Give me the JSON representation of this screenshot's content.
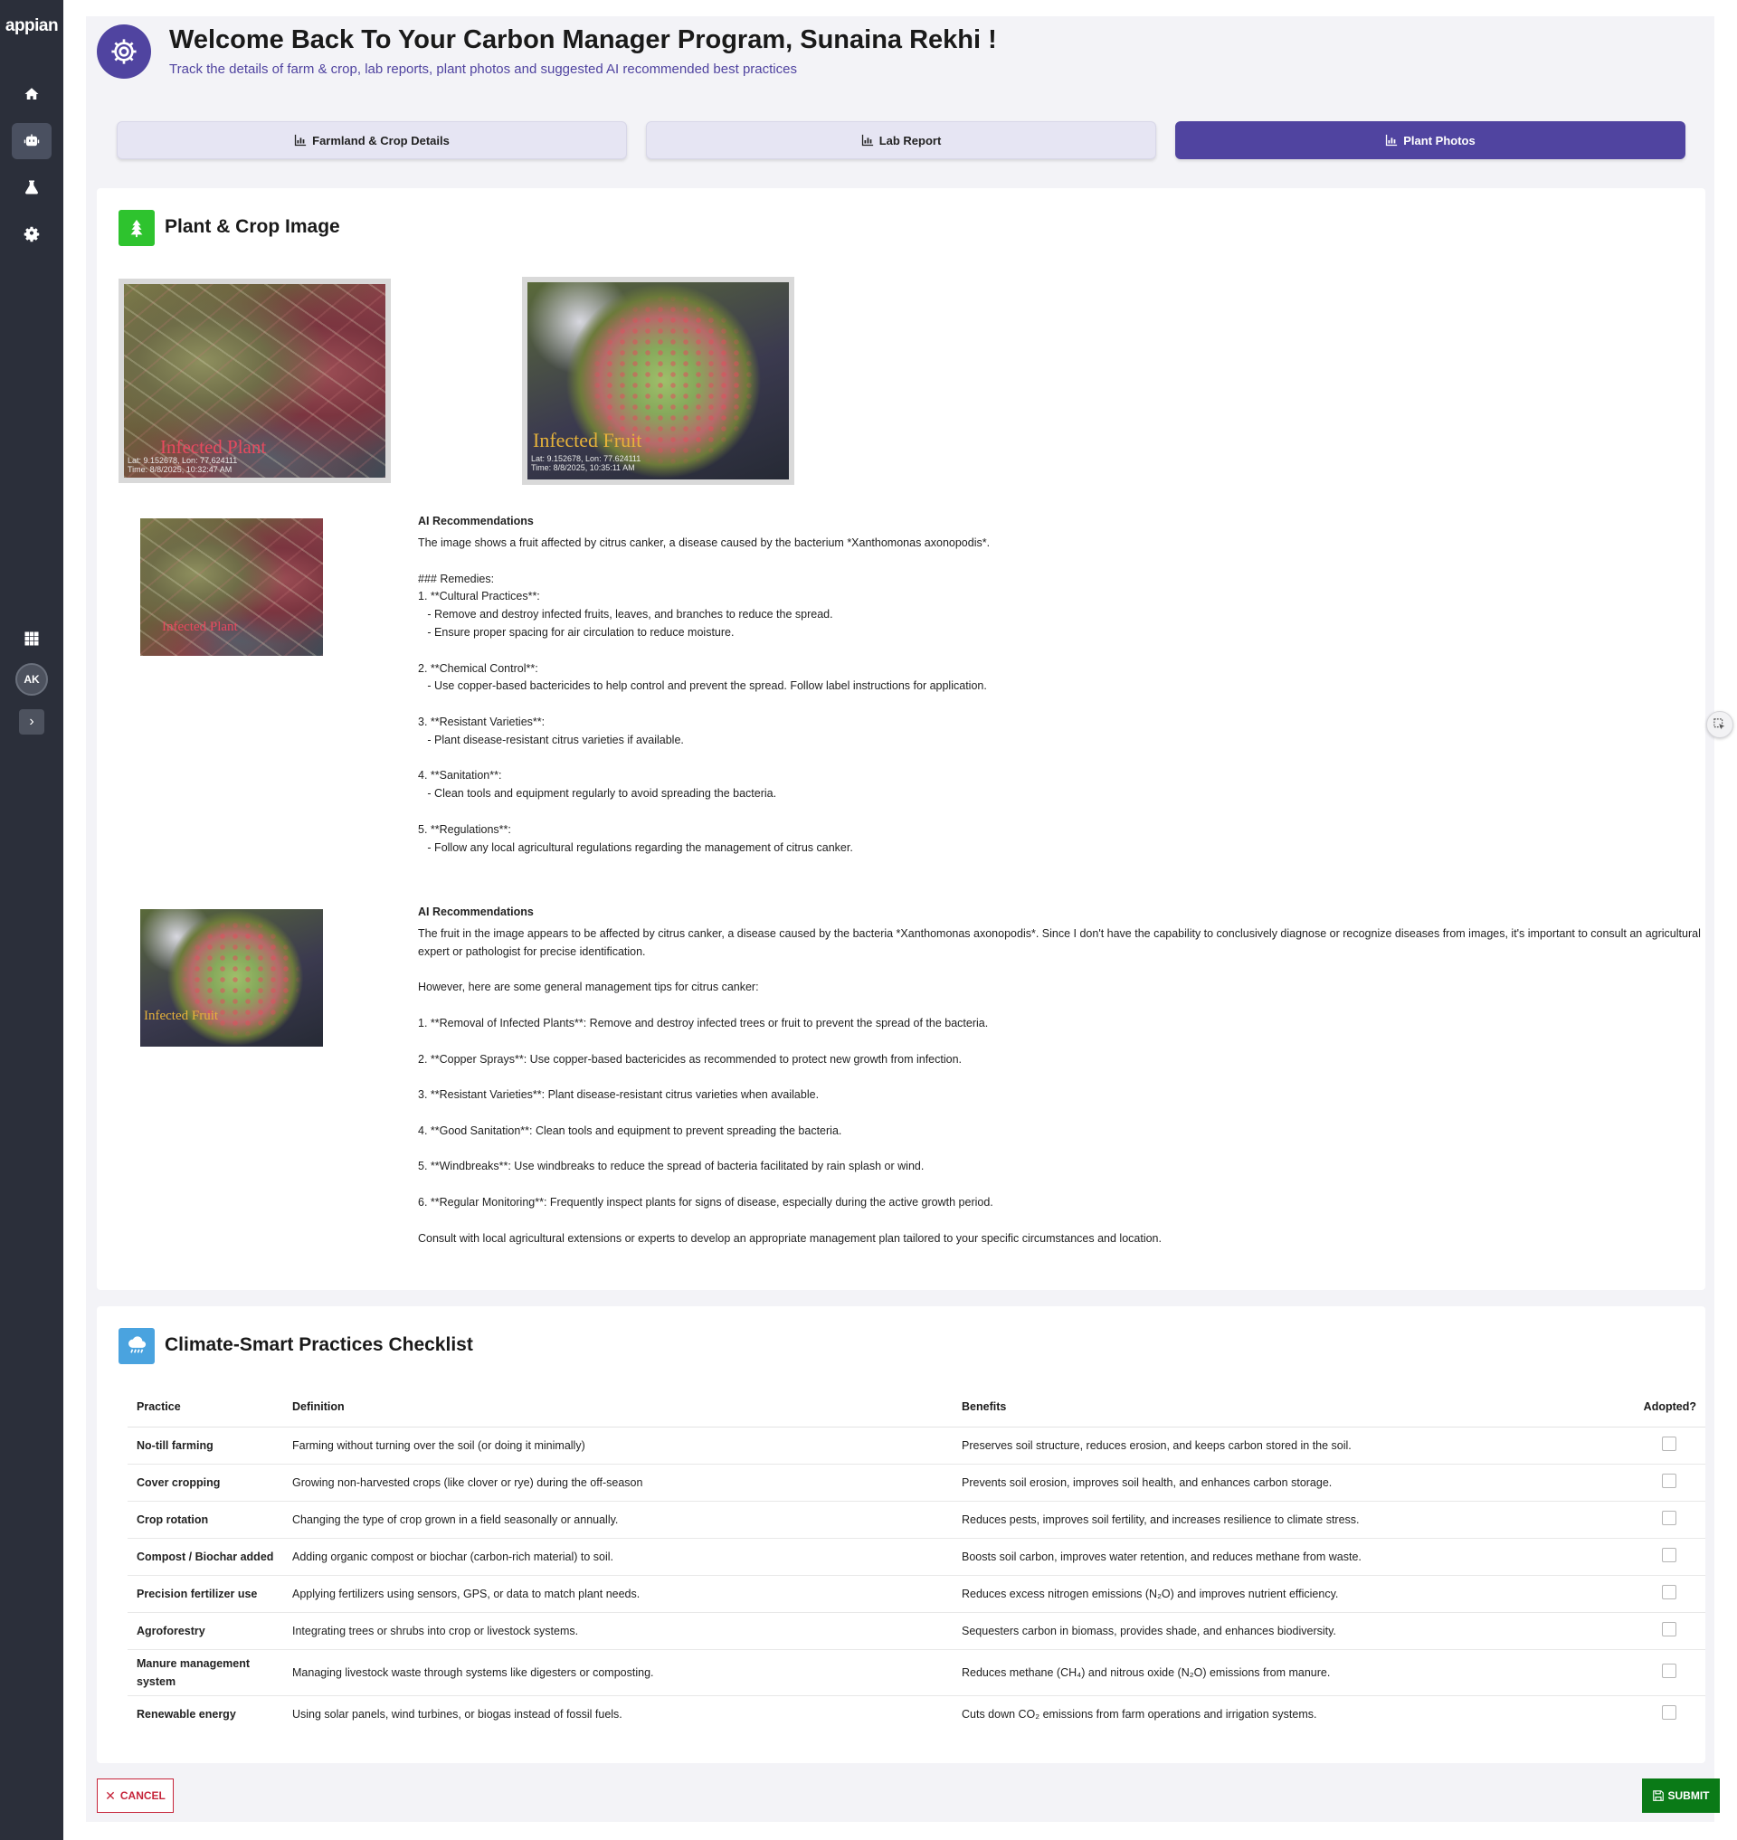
{
  "app": {
    "logo": "appian",
    "user_initials": "AK"
  },
  "colors": {
    "brand": "#5044a0",
    "sidebar": "#2b2f3a",
    "success": "#0a7a17",
    "danger": "#c6253b",
    "plant_icon": "#2ec32e",
    "climate_icon": "#4aa3df"
  },
  "sidebar": {
    "items": [
      {
        "name": "home",
        "icon": "home-icon"
      },
      {
        "name": "robot",
        "icon": "robot-icon",
        "active": true
      },
      {
        "name": "lab",
        "icon": "flask-icon"
      },
      {
        "name": "settings",
        "icon": "gear-icon"
      },
      {
        "name": "apps",
        "icon": "grid-icon"
      }
    ],
    "expand_icon": "chevron-right-icon"
  },
  "header": {
    "title": "Welcome Back To Your Carbon Manager Program, Sunaina Rekhi !",
    "subtitle": "Track the details of farm & crop, lab reports, plant photos and suggested AI recommended best practices",
    "icon": "gear-icon"
  },
  "tabs": [
    {
      "label": "Farmland & Crop Details",
      "icon": "chart-icon",
      "active": false
    },
    {
      "label": "Lab Report",
      "icon": "chart-icon",
      "active": false
    },
    {
      "label": "Plant Photos",
      "icon": "chart-icon",
      "active": true
    }
  ],
  "plant_section": {
    "title": "Plant & Crop Image",
    "icon": "tree-icon",
    "photos": [
      {
        "label": "Infected Plant",
        "lat": "Lat: 9.152678, Lon: 77.624111",
        "time": "Time: 8/8/2025, 10:32:47 AM"
      },
      {
        "label": "Infected Fruit",
        "lat": "Lat: 9.152678, Lon: 77.624111",
        "time": "Time: 8/8/2025, 10:35:11 AM"
      }
    ],
    "recommendations": [
      {
        "heading": "AI Recommendations",
        "text": "The image shows a fruit affected by citrus canker, a disease caused by the bacterium *Xanthomonas axonopodis*.\n\n### Remedies:\n1. **Cultural Practices**:\n   - Remove and destroy infected fruits, leaves, and branches to reduce the spread.\n   - Ensure proper spacing for air circulation to reduce moisture.\n\n2. **Chemical Control**:\n   - Use copper-based bactericides to help control and prevent the spread. Follow label instructions for application.\n\n3. **Resistant Varieties**:\n   - Plant disease-resistant citrus varieties if available.\n\n4. **Sanitation**:\n   - Clean tools and equipment regularly to avoid spreading the bacteria.\n\n5. **Regulations**:\n   - Follow any local agricultural regulations regarding the management of citrus canker."
      },
      {
        "heading": "AI Recommendations",
        "text": "The fruit in the image appears to be affected by citrus canker, a disease caused by the bacteria *Xanthomonas axonopodis*. Since I don't have the capability to conclusively diagnose or recognize diseases from images, it's important to consult an agricultural expert or pathologist for precise identification.\n\nHowever, here are some general management tips for citrus canker:\n\n1. **Removal of Infected Plants**: Remove and destroy infected trees or fruit to prevent the spread of the bacteria.\n\n2. **Copper Sprays**: Use copper-based bactericides as recommended to protect new growth from infection.\n\n3. **Resistant Varieties**: Plant disease-resistant citrus varieties when available.\n\n4. **Good Sanitation**: Clean tools and equipment to prevent spreading the bacteria.\n\n5. **Windbreaks**: Use windbreaks to reduce the spread of bacteria facilitated by rain splash or wind.\n\n6. **Regular Monitoring**: Frequently inspect plants for signs of disease, especially during the active growth period.\n\nConsult with local agricultural extensions or experts to develop an appropriate management plan tailored to your specific circumstances and location."
      }
    ]
  },
  "climate_section": {
    "title": "Climate-Smart Practices Checklist",
    "icon": "rain-cloud-icon",
    "columns": [
      "Practice",
      "Definition",
      "Benefits",
      "Adopted?"
    ],
    "rows": [
      {
        "practice": "No-till farming",
        "definition": "Farming without turning over the soil (or doing it minimally)",
        "benefits": "Preserves soil structure, reduces erosion, and keeps carbon stored in the soil."
      },
      {
        "practice": "Cover cropping",
        "definition": "Growing non-harvested crops (like clover or rye) during the off-season",
        "benefits": "Prevents soil erosion, improves soil health, and enhances carbon storage."
      },
      {
        "practice": "Crop rotation",
        "definition": "Changing the type of crop grown in a field seasonally or annually.",
        "benefits": "Reduces pests, improves soil fertility, and increases resilience to climate stress."
      },
      {
        "practice": "Compost / Biochar added",
        "definition": "Adding organic compost or biochar (carbon-rich material) to soil.",
        "benefits": "Boosts soil carbon, improves water retention, and reduces methane from waste."
      },
      {
        "practice": "Precision fertilizer use",
        "definition": "Applying fertilizers using sensors, GPS, or data to match plant needs.",
        "benefits": "Reduces excess nitrogen emissions (N₂O) and improves nutrient efficiency."
      },
      {
        "practice": "Agroforestry",
        "definition": "Integrating trees or shrubs into crop or livestock systems.",
        "benefits": "Sequesters carbon in biomass, provides shade, and enhances biodiversity."
      },
      {
        "practice": "Manure management system",
        "definition": "Managing livestock waste through systems like digesters or composting.",
        "benefits": "Reduces methane (CH₄) and nitrous oxide (N₂O) emissions from manure."
      },
      {
        "practice": "Renewable energy",
        "definition": "Using solar panels, wind turbines, or biogas instead of fossil fuels.",
        "benefits": "Cuts down CO₂ emissions from farm operations and irrigation systems."
      }
    ]
  },
  "actions": {
    "cancel": "CANCEL",
    "submit": "SUBMIT"
  }
}
